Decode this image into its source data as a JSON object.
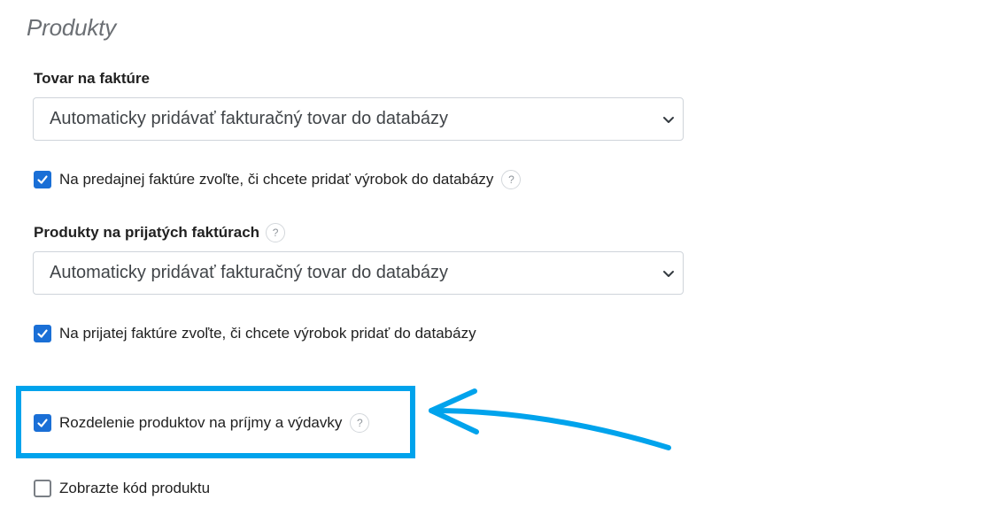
{
  "section": {
    "title": "Produkty"
  },
  "invoice_goods": {
    "label": "Tovar na faktúre",
    "select_value": "Automaticky pridávať fakturačný tovar do databázy",
    "checkbox_label": "Na predajnej faktúre zvoľte, či chcete pridať výrobok do databázy",
    "checkbox_checked": true
  },
  "received_products": {
    "label": "Produkty na prijatých faktúrach",
    "select_value": "Automaticky pridávať fakturačný tovar do databázy",
    "checkbox_label": "Na prijatej faktúre zvoľte, či chcete výrobok pridať do databázy",
    "checkbox_checked": true
  },
  "split_products": {
    "checkbox_label": "Rozdelenie produktov na príjmy a výdavky",
    "checkbox_checked": true
  },
  "show_code": {
    "checkbox_label": "Zobrazte kód produktu",
    "checkbox_checked": false
  },
  "help_glyph": "?",
  "colors": {
    "checkbox_accent": "#1a6fd6",
    "annotation": "#00a3ec",
    "title": "#6b6f74"
  }
}
